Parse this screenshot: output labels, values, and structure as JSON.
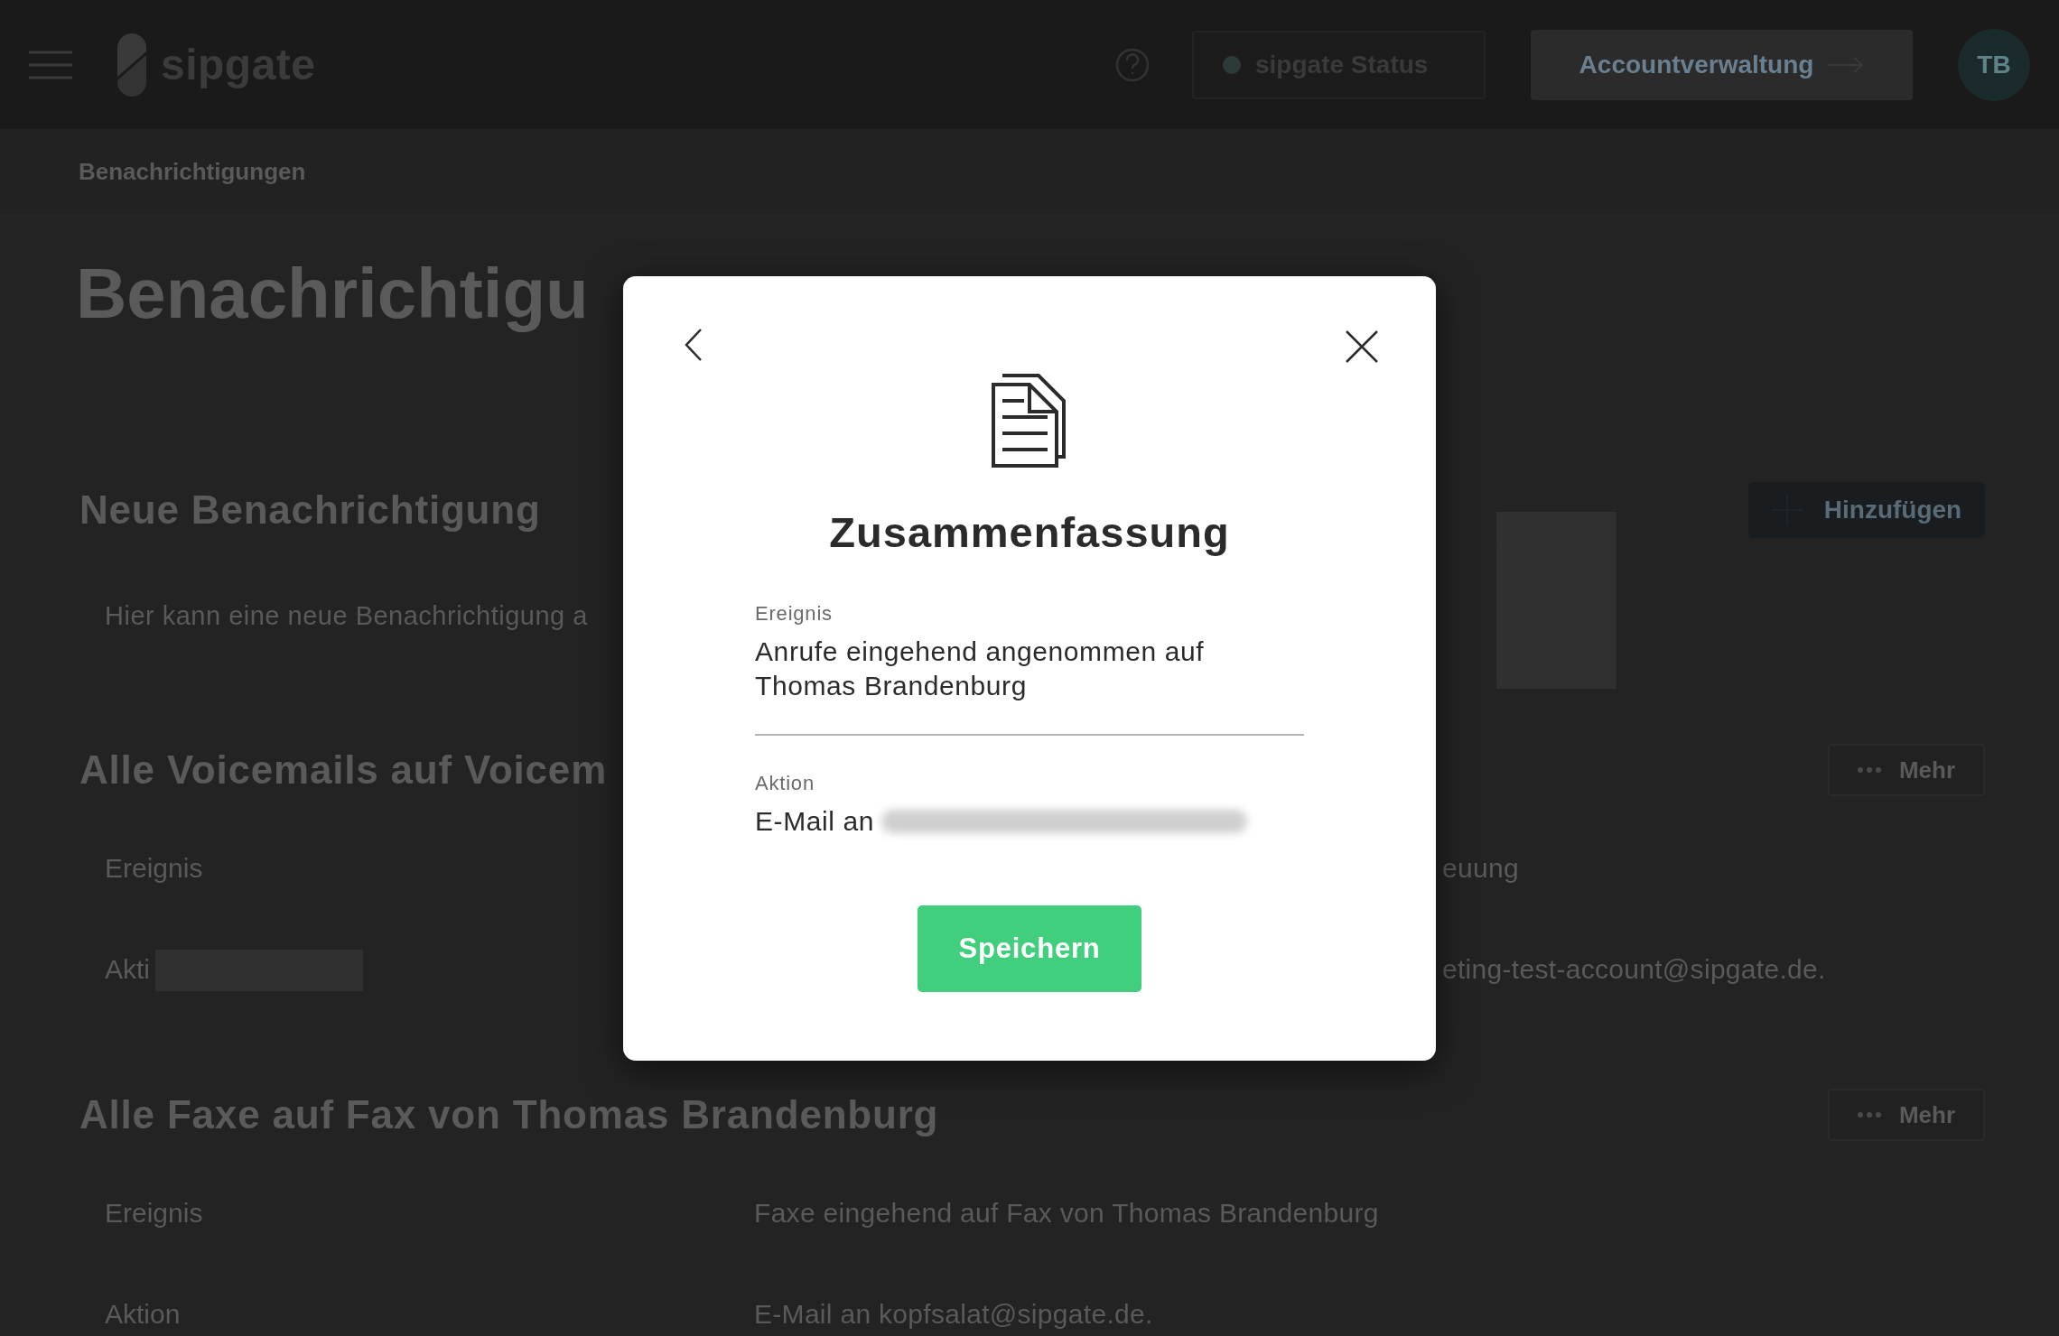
{
  "header": {
    "brand": "sipgate",
    "status_button": "sipgate Status",
    "account_button": "Accountverwaltung",
    "avatar": "TB"
  },
  "breadcrumb": "Benachrichtigungen",
  "page_title": "Benachrichtigu",
  "new_section": {
    "title": "Neue Benachrichtigung",
    "description": "Hier kann eine neue Benachrichtigung a",
    "add_button": "Hinzufügen"
  },
  "notifications": [
    {
      "title": "Alle Voicemails auf Voicem",
      "more_button": "Mehr",
      "covered": true,
      "rows": [
        {
          "label": "Ereignis",
          "value": "euung",
          "redacted": false
        },
        {
          "label": "Akti",
          "value": "eting-test-account@sipgate.de.",
          "redacted": true
        }
      ]
    },
    {
      "title": "Alle Faxe auf Fax von Thomas Brandenburg",
      "more_button": "Mehr",
      "covered": false,
      "rows": [
        {
          "label": "Ereignis",
          "value": "Faxe eingehend auf Fax von Thomas Brandenburg",
          "redacted": false
        },
        {
          "label": "Aktion",
          "value": "E-Mail an kopfsalat@sipgate.de.",
          "redacted": false
        }
      ]
    }
  ],
  "modal": {
    "title": "Zusammenfassung",
    "fields": [
      {
        "label": "Ereignis",
        "value": "Anrufe eingehend angenommen auf Thomas Brandenburg",
        "redacted": false
      },
      {
        "label": "Aktion",
        "value": "E-Mail an",
        "redacted": true
      }
    ],
    "save_button": "Speichern"
  }
}
